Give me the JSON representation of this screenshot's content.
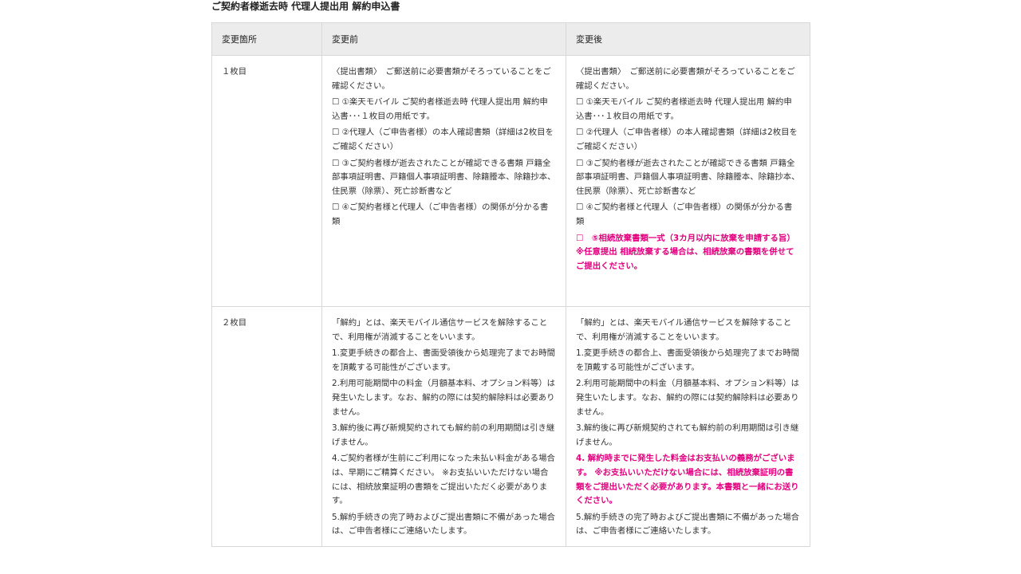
{
  "title": "ご契約者様逝去時 代理人提出用 解約申込書",
  "headers": [
    "変更箇所",
    "変更前",
    "変更後"
  ],
  "rows": [
    {
      "label": "１枚目",
      "before": [
        {
          "text": "〈提出書類〉　ご郵送前に必要書類がそろっていることをご確認ください。",
          "hl": false
        },
        {
          "text": "☐ ①楽天モバイル ご契約者様逝去時 代理人提出用 解約申込書･･･１枚目の用紙です。",
          "hl": false
        },
        {
          "text": "☐ ②代理人（ご申告者様）の本人確認書類（詳細は2枚目をご確認ください）",
          "hl": false
        },
        {
          "text": "☐ ③ご契約者様が逝去されたことが確認できる書類 戸籍全部事項証明書、戸籍個人事項証明書、除籍謄本、除籍抄本、住民票（除票）、死亡診断書など",
          "hl": false
        },
        {
          "text": "☐ ④ご契約者様と代理人（ご申告者様）の関係が分かる書類",
          "hl": false
        }
      ],
      "after": [
        {
          "text": "〈提出書類〉　ご郵送前に必要書類がそろっていることをご確認ください。",
          "hl": false
        },
        {
          "text": "☐ ①楽天モバイル ご契約者様逝去時 代理人提出用 解約申込書･･･１枚目の用紙です。",
          "hl": false
        },
        {
          "text": "☐ ②代理人（ご申告者様）の本人確認書類（詳細は2枚目をご確認ください）",
          "hl": false
        },
        {
          "text": "☐ ③ご契約者様が逝去されたことが確認できる書類 戸籍全部事項証明書、戸籍個人事項証明書、除籍謄本、除籍抄本、住民票（除票）、死亡診断書など",
          "hl": false
        },
        {
          "text": "☐ ④ご契約者様と代理人（ご申告者様）の関係が分かる書類",
          "hl": false
        },
        {
          "text": "☐　⑤相続放棄書類一式（3カ月以内に放棄を申請する旨）※任意提出 相続放棄する場合は、相続放棄の書類を併せてご提出ください。",
          "hl": true
        }
      ]
    },
    {
      "label": "２枚目",
      "before": [
        {
          "text": "「解約」とは、楽天モバイル通信サービスを解除することで、利用権が消滅することをいいます。",
          "hl": false
        },
        {
          "text": "1.変更手続きの都合上、書面受領後から処理完了までお時間を頂戴する可能性がございます。",
          "hl": false
        },
        {
          "text": "2.利用可能期間中の料金（月額基本料、オプション料等）は発生いたします。なお、解約の際には契約解除料は必要ありません。",
          "hl": false
        },
        {
          "text": "3.解約後に再び新規契約されても解約前の利用期間は引き継げません。",
          "hl": false
        },
        {
          "text": "4.ご契約者様が生前にご利用になった未払い料金がある場合は、早期にご精算ください。 ※お支払いいただけない場合には、相続放棄証明の書類をご提出いただく必要があります。",
          "hl": false
        },
        {
          "text": "5.解約手続きの完了時およびご提出書類に不備があった場合は、ご申告者様にご連絡いたします。",
          "hl": false
        }
      ],
      "after": [
        {
          "text": "「解約」とは、楽天モバイル通信サービスを解除することで、利用権が消滅することをいいます。",
          "hl": false
        },
        {
          "text": "1.変更手続きの都合上、書面受領後から処理完了までお時間を頂戴する可能性がございます。",
          "hl": false
        },
        {
          "text": "2.利用可能期間中の料金（月額基本料、オプション料等）は発生いたします。なお、解約の際には契約解除料は必要ありません。",
          "hl": false
        },
        {
          "text": "3.解約後に再び新規契約されても解約前の利用期間は引き継げません。",
          "hl": false
        },
        {
          "text": "4. 解約時までに発生した料金はお支払いの義務がございます。 ※お支払いいただけない場合には、相続放棄証明の書類をご提出いただく必要があります。本書類と一緒にお送りください。",
          "hl": true
        },
        {
          "text": "5.解約手続きの完了時およびご提出書類に不備があった場合は、ご申告者様にご連絡いたします。",
          "hl": false
        }
      ]
    }
  ]
}
